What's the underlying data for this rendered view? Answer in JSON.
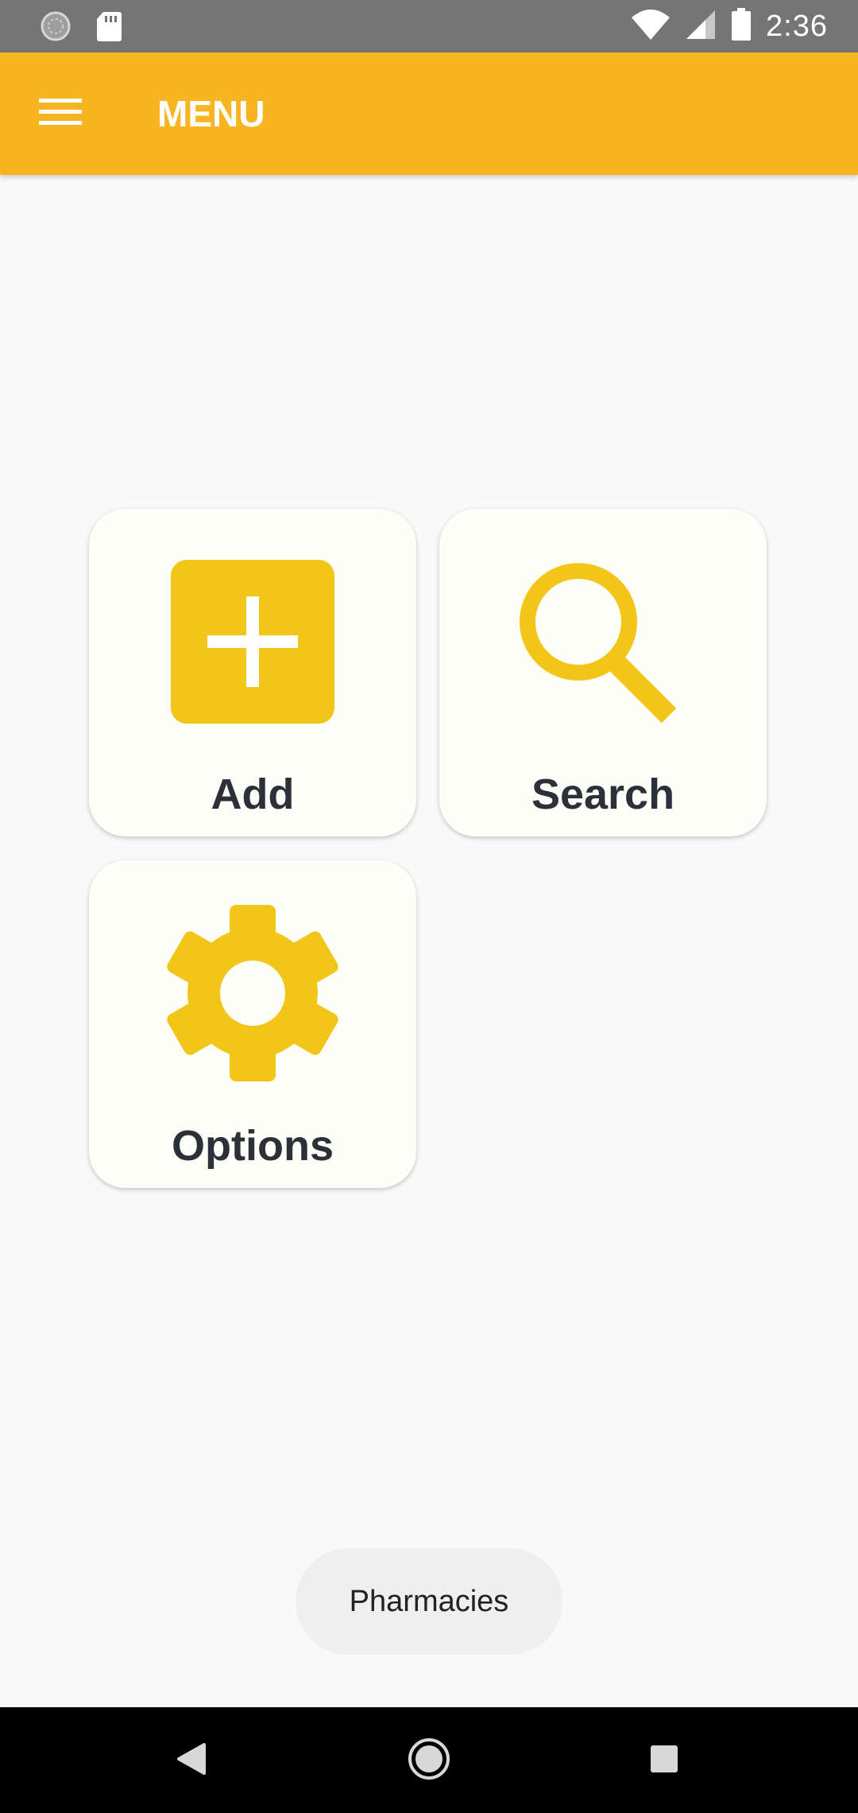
{
  "status_bar": {
    "time": "2:36",
    "icons": [
      "sync-icon",
      "sd-card-icon",
      "wifi-icon",
      "signal-icon",
      "battery-icon"
    ]
  },
  "app_bar": {
    "title": "MENU",
    "menu_icon": "hamburger-icon",
    "color": "#f7b521"
  },
  "tiles": [
    {
      "label": "Add",
      "icon": "add-icon"
    },
    {
      "label": "Search",
      "icon": "search-icon"
    },
    {
      "label": "Options",
      "icon": "gear-icon"
    }
  ],
  "accent_color": "#f2c618",
  "toast": {
    "text": "Pharmacies"
  },
  "nav_bar": {
    "icons": [
      "back-icon",
      "home-icon",
      "recents-icon"
    ]
  }
}
